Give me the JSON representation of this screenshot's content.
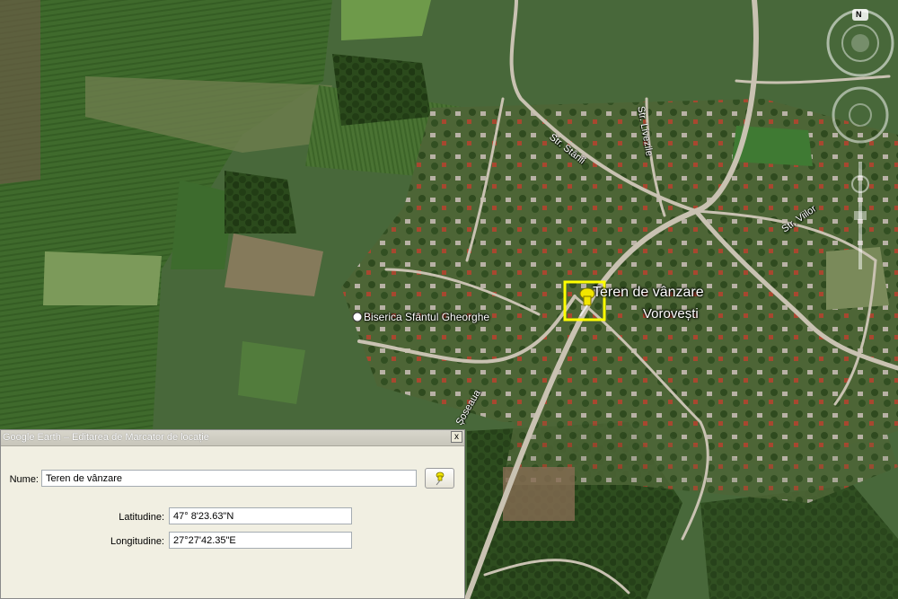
{
  "map": {
    "placemark_label": "Teren de vânzare",
    "village_label": "Vorovești",
    "church_label": "Biserica Sfântul Gheorghe",
    "streets": [
      "Str. Stânii",
      "Str. Livezile",
      "Str. Viilor",
      "Șoseaua"
    ],
    "compass_letter": "N"
  },
  "dialog": {
    "title": "Google Earth – Editarea de Marcator de locație",
    "close_label": "x",
    "name_label": "Nume:",
    "name_value": "Teren de vânzare",
    "lat_label": "Latitudine:",
    "lat_value": "47° 8'23.63\"N",
    "lon_label": "Longitudine:",
    "lon_value": "27°27'42.35\"E"
  },
  "colors": {
    "placemark_highlight": "#ffff00",
    "pin": "#f2e600"
  }
}
